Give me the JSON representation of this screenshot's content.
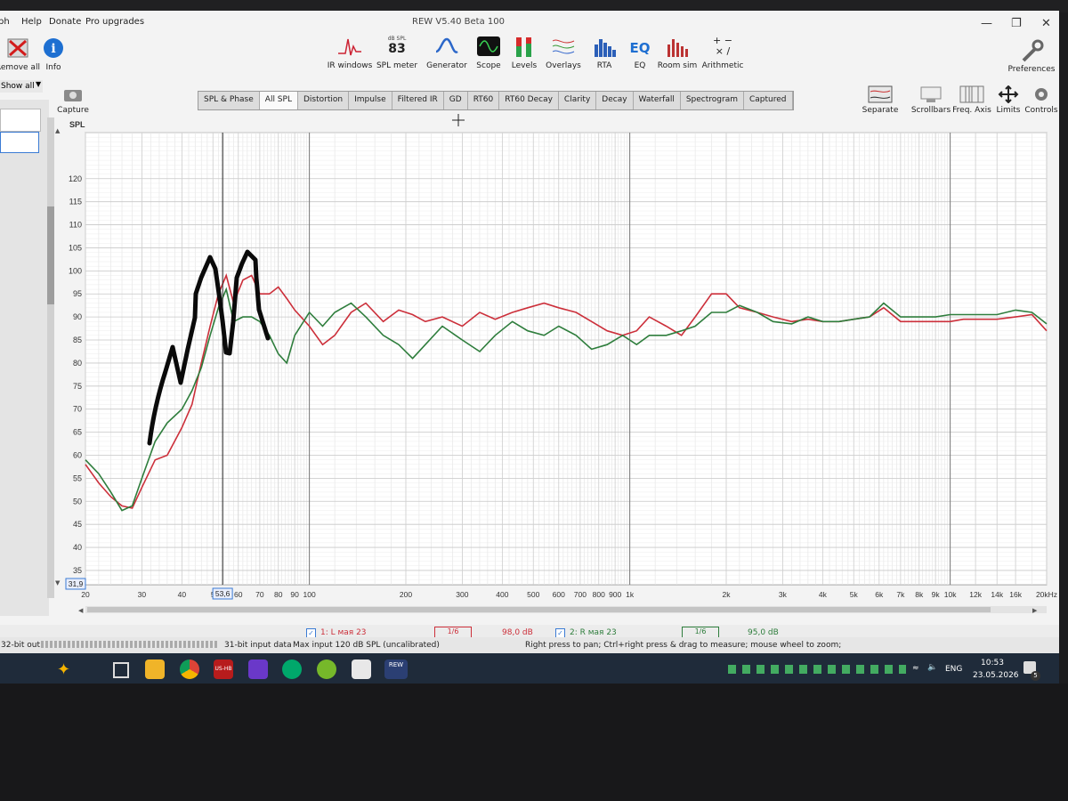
{
  "app": {
    "window_title": "REW V5.40 Beta 100",
    "menu": [
      "ph",
      "Help",
      "Donate",
      "Pro upgrades"
    ]
  },
  "toolbar": {
    "remove_all": "Remove all",
    "info": "Info",
    "show_all": "Show all",
    "capture": "Capture",
    "ir_windows": "IR windows",
    "spl_meter_label": "SPL meter",
    "spl_meter_small": "dB SPL",
    "spl_meter_value": "83",
    "generator": "Generator",
    "scope": "Scope",
    "levels": "Levels",
    "overlays": "Overlays",
    "rta": "RTA",
    "eq": "EQ",
    "room_sim": "Room sim",
    "arithmetic": "Arithmetic",
    "preferences": "Preferences",
    "separate": "Separate",
    "scrollbars": "Scrollbars",
    "freq_axis": "Freq. Axis",
    "limits": "Limits",
    "controls": "Controls"
  },
  "tabs": [
    "SPL & Phase",
    "All SPL",
    "Distortion",
    "Impulse",
    "Filtered IR",
    "GD",
    "RT60",
    "RT60 Decay",
    "Clarity",
    "Decay",
    "Waterfall",
    "Spectrogram",
    "Captured"
  ],
  "active_tab": "All SPL",
  "chart_data": {
    "type": "line",
    "ylabel": "SPL",
    "x_scale": "log",
    "xlim": [
      20,
      20000
    ],
    "ylim": [
      31.9,
      130
    ],
    "y_ticks": [
      35,
      40,
      45,
      50,
      55,
      60,
      65,
      70,
      75,
      80,
      85,
      90,
      95,
      100,
      105,
      110,
      115,
      120
    ],
    "y_min_readout": "31,9",
    "x_ticks": [
      {
        "v": 20,
        "t": "20"
      },
      {
        "v": 30,
        "t": "30"
      },
      {
        "v": 40,
        "t": "40"
      },
      {
        "v": 50,
        "t": "5"
      },
      {
        "v": 60,
        "t": "60"
      },
      {
        "v": 70,
        "t": "70"
      },
      {
        "v": 80,
        "t": "80"
      },
      {
        "v": 90,
        "t": "90"
      },
      {
        "v": 100,
        "t": "100"
      },
      {
        "v": 200,
        "t": "200"
      },
      {
        "v": 300,
        "t": "300"
      },
      {
        "v": 400,
        "t": "400"
      },
      {
        "v": 500,
        "t": "500"
      },
      {
        "v": 600,
        "t": "600"
      },
      {
        "v": 700,
        "t": "700"
      },
      {
        "v": 800,
        "t": "800"
      },
      {
        "v": 900,
        "t": "900"
      },
      {
        "v": 1000,
        "t": "1k"
      },
      {
        "v": 2000,
        "t": "2k"
      },
      {
        "v": 3000,
        "t": "3k"
      },
      {
        "v": 4000,
        "t": "4k"
      },
      {
        "v": 5000,
        "t": "5k"
      },
      {
        "v": 6000,
        "t": "6k"
      },
      {
        "v": 7000,
        "t": "7k"
      },
      {
        "v": 8000,
        "t": "8k"
      },
      {
        "v": 9000,
        "t": "9k"
      },
      {
        "v": 10000,
        "t": "10k"
      },
      {
        "v": 12000,
        "t": "12k"
      },
      {
        "v": 14000,
        "t": "14k"
      },
      {
        "v": 16000,
        "t": "16k"
      },
      {
        "v": 20000,
        "t": "20kHz"
      }
    ],
    "cursor_freq": 53.6,
    "cursor_readout": "53,6",
    "series": [
      {
        "name": "1: L мая 23",
        "color": "#cc2f3a",
        "x": [
          20,
          22,
          24,
          26,
          28,
          30,
          33,
          36,
          40,
          43,
          46,
          49,
          52,
          55,
          58,
          62,
          66,
          70,
          75,
          80,
          85,
          90,
          100,
          110,
          120,
          135,
          150,
          170,
          190,
          210,
          230,
          260,
          300,
          340,
          380,
          430,
          480,
          540,
          600,
          680,
          760,
          850,
          950,
          1050,
          1150,
          1300,
          1450,
          1600,
          1800,
          2000,
          2200,
          2500,
          2800,
          3200,
          3600,
          4000,
          4500,
          5000,
          5600,
          6200,
          7000,
          8000,
          9000,
          10000,
          11000,
          12500,
          14000,
          16000,
          18000,
          20000
        ],
        "values": [
          58,
          54,
          51,
          49,
          48.5,
          53,
          59,
          60,
          66,
          71,
          80,
          88,
          95,
          99,
          93,
          98,
          99,
          95,
          95,
          96.5,
          94,
          91.5,
          88,
          84,
          86,
          91,
          93,
          89,
          91.5,
          90.5,
          89,
          90,
          88,
          91,
          89.5,
          91,
          92,
          93,
          92,
          91,
          89,
          87,
          86,
          87,
          90,
          88,
          86,
          90,
          95,
          95,
          92,
          91,
          90,
          89,
          89.5,
          89,
          89,
          89.5,
          90,
          92,
          89,
          89,
          89,
          89,
          89.5,
          89.5,
          89.5,
          90,
          90.5,
          87
        ]
      },
      {
        "name": "2: R мая 23",
        "color": "#2e7d3c",
        "x": [
          20,
          22,
          24,
          26,
          28,
          30,
          33,
          36,
          40,
          43,
          46,
          49,
          52,
          55,
          58,
          62,
          66,
          70,
          75,
          80,
          85,
          90,
          100,
          110,
          120,
          135,
          150,
          170,
          190,
          210,
          230,
          260,
          300,
          340,
          380,
          430,
          480,
          540,
          600,
          680,
          760,
          850,
          950,
          1050,
          1150,
          1300,
          1450,
          1600,
          1800,
          2000,
          2200,
          2500,
          2800,
          3200,
          3600,
          4000,
          4500,
          5000,
          5600,
          6200,
          7000,
          8000,
          9000,
          10000,
          11000,
          12500,
          14000,
          16000,
          18000,
          20000
        ],
        "values": [
          59,
          56,
          52,
          48,
          49,
          55,
          63,
          67,
          70,
          74,
          79,
          86,
          92,
          96,
          89,
          90,
          90,
          89,
          86,
          82,
          80,
          86,
          91,
          88,
          91,
          93,
          90,
          86,
          84,
          81,
          84,
          88,
          85,
          82.5,
          86,
          89,
          87,
          86,
          88,
          86,
          83,
          84,
          86,
          84,
          86,
          86,
          87,
          88,
          91,
          91,
          92.5,
          91,
          89,
          88.5,
          90,
          89,
          89,
          89.5,
          90,
          93,
          90,
          90,
          90,
          90.5,
          90.5,
          90.5,
          90.5,
          91.5,
          91,
          88.5
        ]
      }
    ],
    "legend": [
      {
        "label": "1: L мая 23",
        "smoothing": "1/6",
        "level": "98,0 dB",
        "color": "#cc2f3a"
      },
      {
        "label": "2: R мая 23",
        "smoothing": "1/6",
        "level": "95,0 dB",
        "color": "#2e7d3c"
      }
    ]
  },
  "status": {
    "bit_out": "32-bit out",
    "bit_in": "31-bit input data",
    "max_input": "Max input 120 dB SPL (uncalibrated)",
    "hint": "Right press to pan; Ctrl+right press & drag to measure; mouse wheel to zoom;"
  },
  "taskbar": {
    "lang": "ENG",
    "time": "10:53",
    "date": "23.05.2026",
    "notif_count": "5",
    "rew_label": "REW",
    "app_label": "US-НВ"
  },
  "colors": {
    "left_channel": "#cc2f3a",
    "right_channel": "#2e7d3c",
    "taskbar": "#1f2b3a"
  }
}
